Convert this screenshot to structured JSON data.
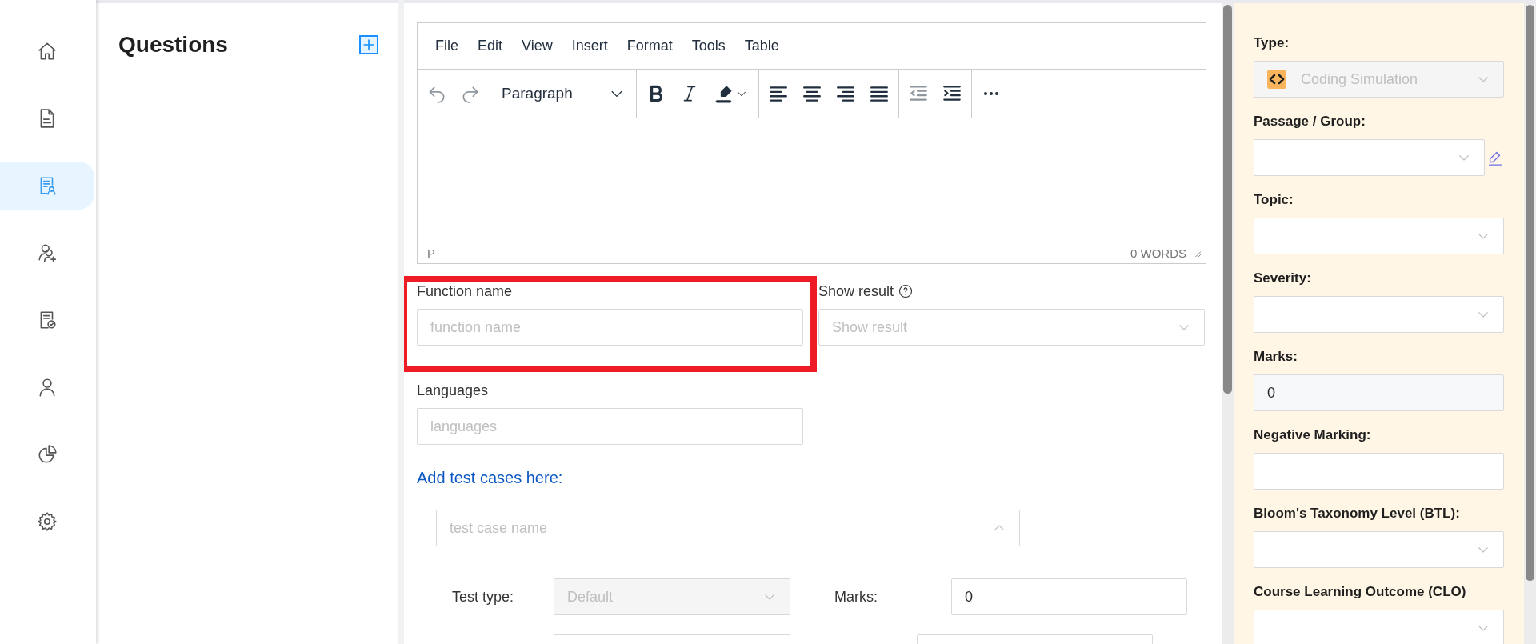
{
  "nav": [
    {
      "kind": "home",
      "selected": false
    },
    {
      "kind": "document",
      "selected": false
    },
    {
      "kind": "document-person",
      "selected": true
    },
    {
      "kind": "people-add",
      "selected": false
    },
    {
      "kind": "document-check",
      "selected": false
    },
    {
      "kind": "person",
      "selected": false
    },
    {
      "kind": "pie",
      "selected": false
    },
    {
      "kind": "gear",
      "selected": false
    }
  ],
  "questions_panel": {
    "title": "Questions"
  },
  "editor": {
    "menu": [
      "File",
      "Edit",
      "View",
      "Insert",
      "Format",
      "Tools",
      "Table"
    ],
    "toolbar": [
      [
        {
          "kind": "undo",
          "disabled": true
        },
        {
          "kind": "redo",
          "disabled": true
        }
      ],
      [
        {
          "kind": "block-format",
          "label": "Paragraph"
        }
      ],
      [
        {
          "kind": "bold",
          "disabled": false
        },
        {
          "kind": "italic",
          "disabled": false
        },
        {
          "kind": "highlight",
          "disabled": false
        }
      ],
      [
        {
          "kind": "align-left",
          "disabled": false
        },
        {
          "kind": "align-center",
          "disabled": false
        },
        {
          "kind": "align-right",
          "disabled": false
        },
        {
          "kind": "justify",
          "disabled": false
        }
      ],
      [
        {
          "kind": "outdent",
          "disabled": true
        },
        {
          "kind": "indent",
          "disabled": false
        }
      ],
      [
        {
          "kind": "more",
          "disabled": false
        }
      ]
    ],
    "status_path": "P",
    "word_count": "0 WORDS"
  },
  "form": {
    "function_name": {
      "label": "Function name",
      "placeholder": "function name"
    },
    "show_result": {
      "label": "Show result",
      "placeholder": "Show result"
    },
    "languages": {
      "label": "Languages",
      "placeholder": "languages"
    },
    "test_cases_link": "Add test cases here:",
    "test_case": {
      "placeholder": "test case name",
      "expanded": true,
      "test_type": {
        "label": "Test type:",
        "value": "Default",
        "disabled": true
      },
      "marks": {
        "label": "Marks:",
        "value": "0"
      }
    }
  },
  "properties": [
    {
      "kind": "type-select",
      "label": "Type:",
      "value": "Coding Simulation",
      "disabled": true
    },
    {
      "kind": "select-edit",
      "label": "Passage / Group:"
    },
    {
      "kind": "select",
      "label": "Topic:"
    },
    {
      "kind": "select",
      "label": "Severity:"
    },
    {
      "kind": "readonly",
      "label": "Marks:",
      "value": "0"
    },
    {
      "kind": "input",
      "label": "Negative Marking:"
    },
    {
      "kind": "select",
      "label": "Bloom's Taxonomy Level (BTL):"
    },
    {
      "kind": "select",
      "label": "Course Learning Outcome (CLO)"
    }
  ]
}
